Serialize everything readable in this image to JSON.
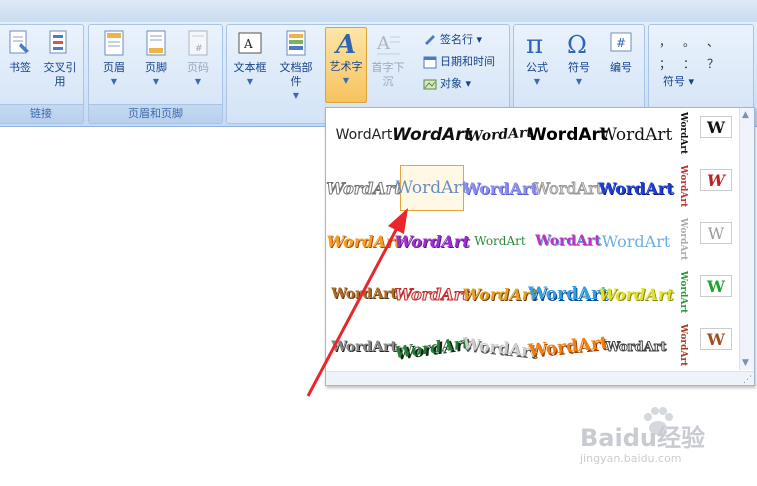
{
  "ribbon": {
    "groups": [
      {
        "label": "链接",
        "buttons": [
          "书签",
          "交叉引用"
        ]
      },
      {
        "label": "页眉和页脚",
        "buttons": [
          "页眉",
          "页脚",
          "页码"
        ]
      },
      {
        "label": "",
        "buttons": [
          "文本框",
          "文档部件",
          "艺术字",
          "首字下沉"
        ]
      },
      {
        "label": "",
        "buttons": [
          "公式",
          "符号",
          "编号"
        ]
      }
    ],
    "small_buttons": [
      "签名行",
      "日期和时间",
      "对象"
    ],
    "symbol_panel": {
      "label": "符号",
      "chars": [
        "，",
        "。",
        "、",
        "；",
        "：",
        "？"
      ]
    }
  },
  "gallery": {
    "text": "WordArt",
    "rows": [
      [
        "WordArt",
        "WordArt",
        "WordArt",
        "WordArt",
        "WordArt"
      ],
      [
        "WordArt",
        "WordArt",
        "WordArt",
        "WordArt",
        "WordArt"
      ],
      [
        "WordArt",
        "WordArt",
        "WordArt",
        "WordArt",
        "WordArt"
      ],
      [
        "WordArt",
        "WordArt",
        "WordArt",
        "WordArt",
        "WordArt"
      ],
      [
        "WordArt",
        "WordArt",
        "WordArt",
        "WordArt",
        "WordArt"
      ]
    ],
    "vertical_text": "WordArt",
    "w_letter": "W",
    "selected": {
      "row": 1,
      "col": 1
    }
  },
  "watermark": {
    "brand": "Baidu经验",
    "url": "jingyan.baidu.com"
  },
  "colors": {
    "ribbon_bg": "#d5e5f7",
    "accent": "#15428b",
    "selected": "#f7c25f",
    "arrow": "#e8262c"
  }
}
